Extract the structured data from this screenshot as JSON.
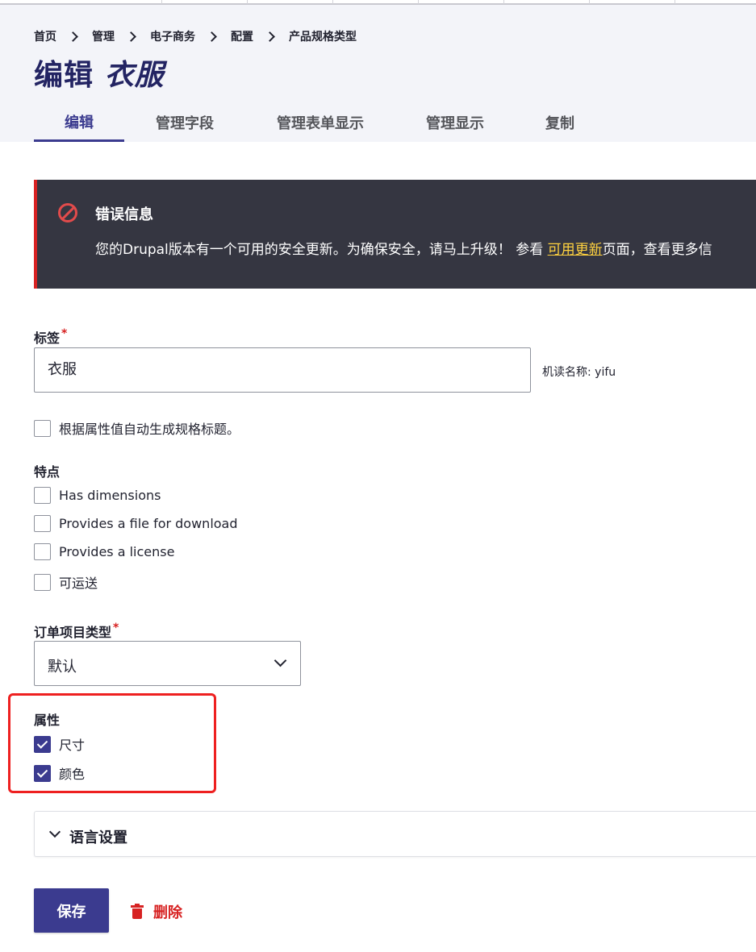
{
  "breadcrumb": [
    "首页",
    "管理",
    "电子商务",
    "配置",
    "产品规格类型"
  ],
  "page_title": {
    "prefix": "编辑",
    "name": "衣服"
  },
  "tabs": [
    "编辑",
    "管理字段",
    "管理表单显示",
    "管理显示",
    "复制"
  ],
  "alert": {
    "title": "错误信息",
    "text_before": "您的Drupal版本有一个可用的安全更新。为确保安全，请马上升级！ 参看 ",
    "link": "可用更新",
    "text_after": "页面，查看更多信"
  },
  "label_field": {
    "label": "标签",
    "value": "衣服",
    "machine_name": "机读名称: yifu"
  },
  "auto_title": {
    "label": "根据属性值自动生成规格标题。",
    "checked": false
  },
  "traits": {
    "label": "特点",
    "items": [
      {
        "label": "Has dimensions",
        "checked": false
      },
      {
        "label": "Provides a file for download",
        "checked": false
      },
      {
        "label": "Provides a license",
        "checked": false
      },
      {
        "label": "可运送",
        "checked": false
      }
    ]
  },
  "order_item_type": {
    "label": "订单项目类型",
    "selected": "默认"
  },
  "attributes": {
    "label": "属性",
    "items": [
      {
        "label": "尺寸",
        "checked": true
      },
      {
        "label": "颜色",
        "checked": true
      }
    ]
  },
  "language_settings": "语言设置",
  "actions": {
    "save": "保存",
    "delete": "删除"
  },
  "colors": {
    "accent": "#3b3b8f",
    "danger": "#d72222",
    "title": "#232463",
    "alert_bg": "#353641",
    "link": "#ffd23f"
  }
}
